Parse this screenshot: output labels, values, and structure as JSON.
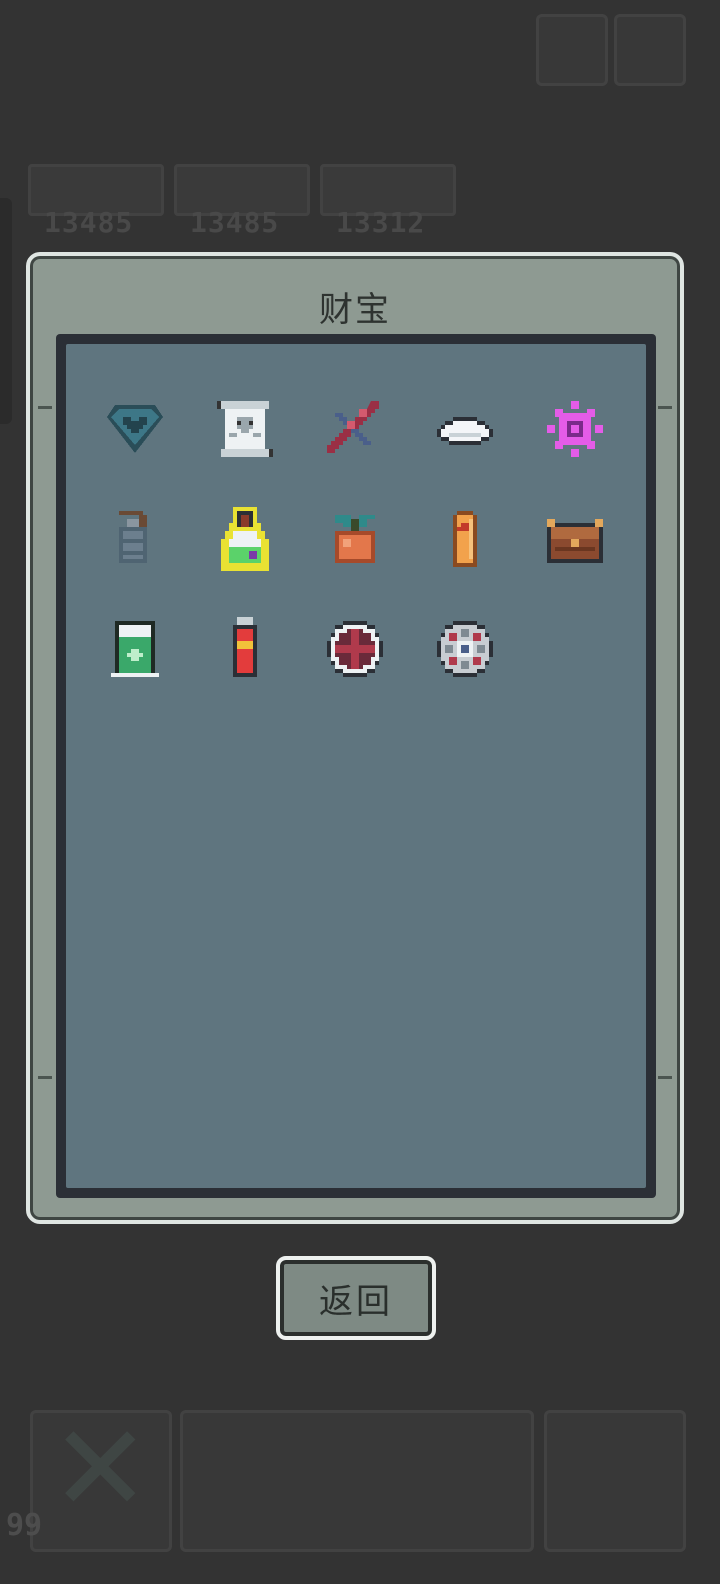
{
  "background_hud": {
    "scores": [
      "13485",
      "13485",
      "13312"
    ],
    "bottom_count": "99"
  },
  "dialog": {
    "title": "财宝",
    "items": [
      {
        "name": "heart-diamond-icon",
        "color": "#3d6f7c"
      },
      {
        "name": "skull-scroll-icon",
        "color": "#e8eef0"
      },
      {
        "name": "dna-helix-icon",
        "color": "#9a2f45"
      },
      {
        "name": "white-stone-icon",
        "color": "#f4f6f8"
      },
      {
        "name": "pink-gear-icon",
        "color": "#e45ce8"
      },
      {
        "name": "grenade-icon",
        "color": "#6c7f8e"
      },
      {
        "name": "potion-flask-icon",
        "color": "#5bd26a"
      },
      {
        "name": "orange-fruit-icon",
        "color": "#e3774b"
      },
      {
        "name": "bullet-icon",
        "color": "#f2a24c"
      },
      {
        "name": "treasure-chest-icon",
        "color": "#8b4a2f"
      },
      {
        "name": "recycle-bin-icon",
        "color": "#3aa86a"
      },
      {
        "name": "battery-icon",
        "color": "#e33c3c"
      },
      {
        "name": "crosshair-icon",
        "color": "#b03a4c"
      },
      {
        "name": "circuit-chip-icon",
        "color": "#c8cdd2"
      }
    ]
  },
  "back_button": {
    "label": "返回"
  }
}
